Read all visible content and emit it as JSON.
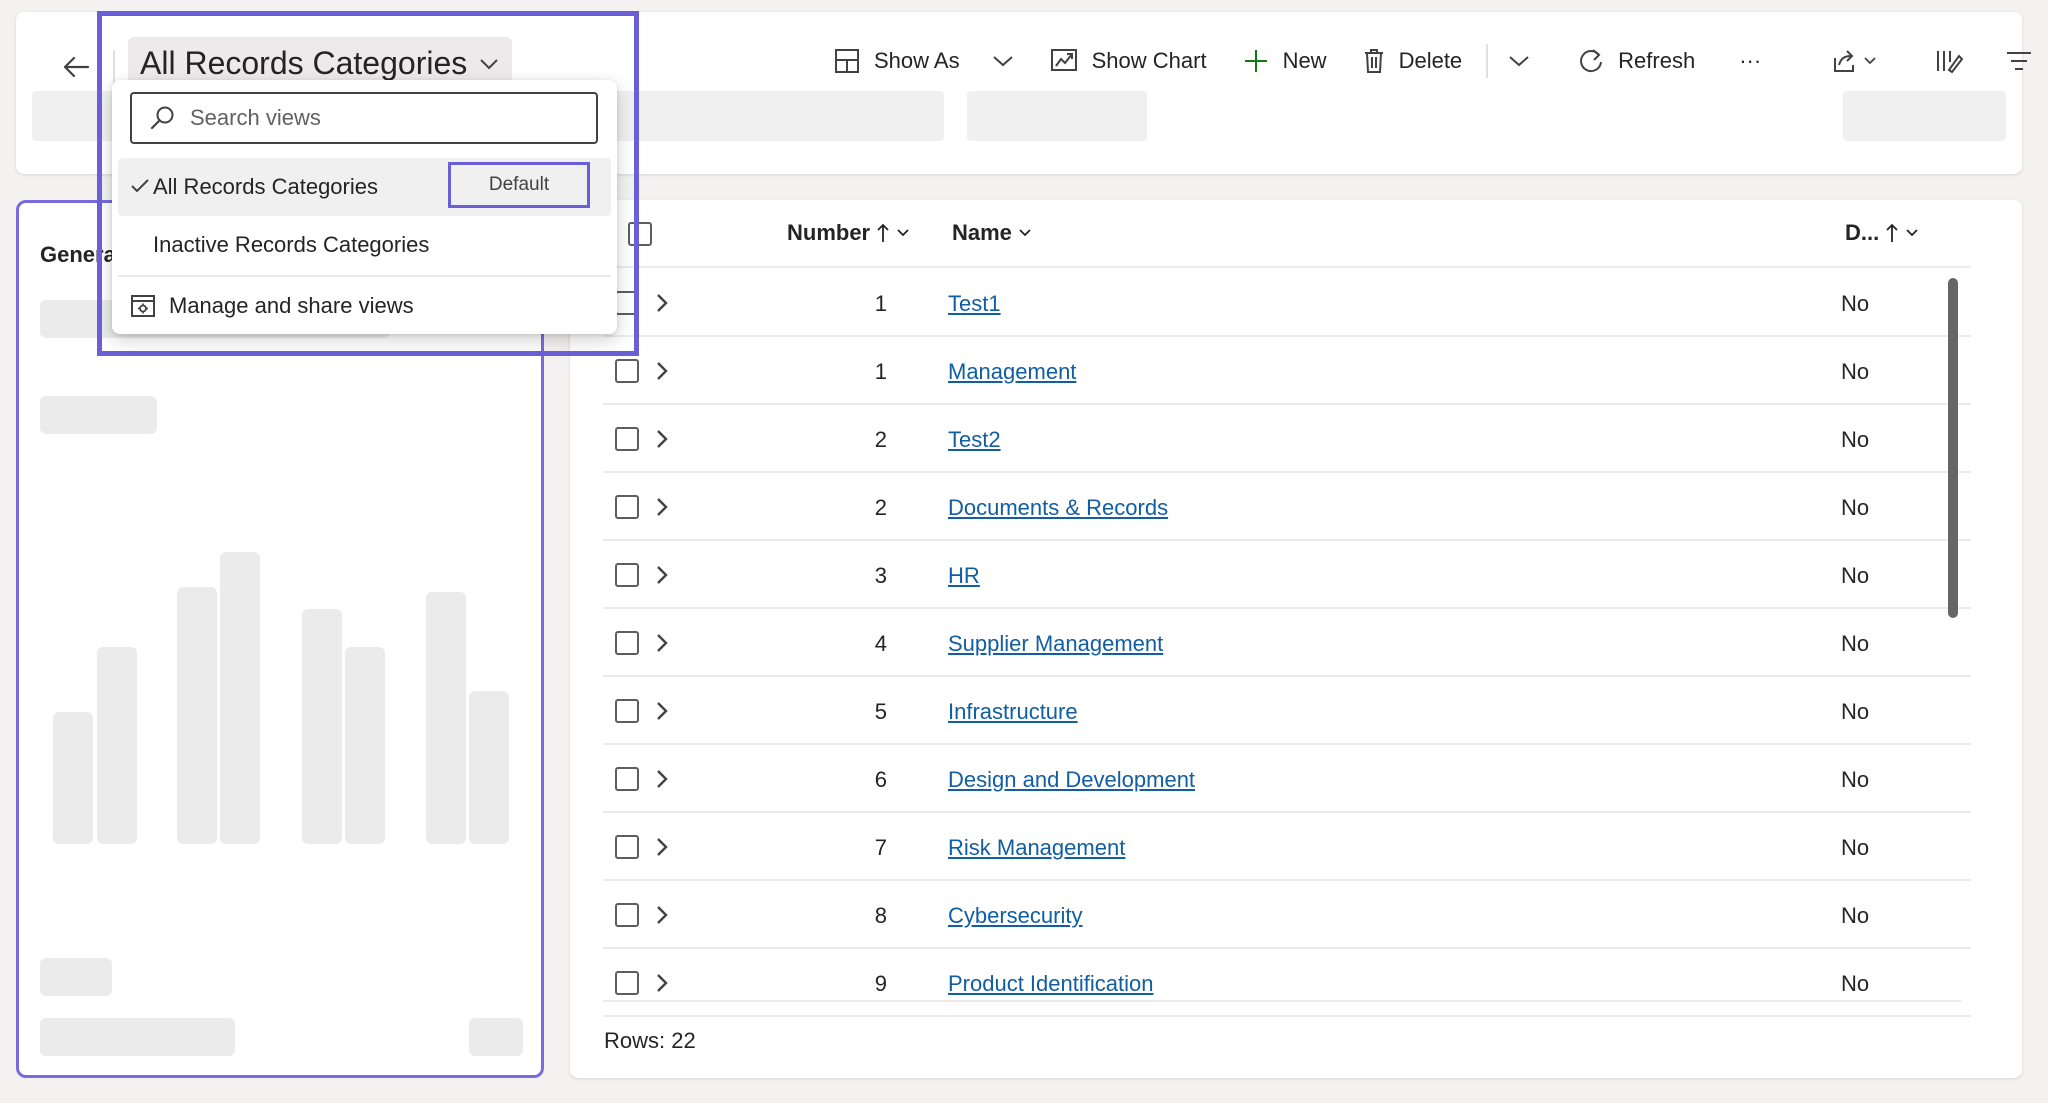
{
  "header": {
    "view_title": "All Records Categories"
  },
  "toolbar": {
    "show_as": "Show As",
    "show_chart": "Show Chart",
    "new": "New",
    "delete": "Delete",
    "refresh": "Refresh",
    "more": "···"
  },
  "view_dropdown": {
    "search_placeholder": "Search views",
    "items": [
      {
        "label": "All Records Categories",
        "selected": true,
        "badge": "Default"
      },
      {
        "label": "Inactive Records Categories",
        "selected": false
      }
    ],
    "manage_label": "Manage and share views"
  },
  "left_panel": {
    "title_visible": "Genera"
  },
  "grid": {
    "columns": [
      {
        "label": "Number",
        "sort": "ascending"
      },
      {
        "label": "Name"
      },
      {
        "label": "D...",
        "sort": "ascending"
      }
    ],
    "rows": [
      {
        "number": "1",
        "name": "Test1",
        "default": "No"
      },
      {
        "number": "1",
        "name": "Management",
        "default": "No"
      },
      {
        "number": "2",
        "name": "Test2",
        "default": "No"
      },
      {
        "number": "2",
        "name": "Documents & Records",
        "default": "No"
      },
      {
        "number": "3",
        "name": "HR",
        "default": "No"
      },
      {
        "number": "4",
        "name": "Supplier Management",
        "default": "No"
      },
      {
        "number": "5",
        "name": "Infrastructure",
        "default": "No"
      },
      {
        "number": "6",
        "name": "Design and Development",
        "default": "No"
      },
      {
        "number": "7",
        "name": "Risk Management",
        "default": "No"
      },
      {
        "number": "8",
        "name": "Cybersecurity",
        "default": "No"
      },
      {
        "number": "9",
        "name": "Product Identification",
        "default": "No"
      }
    ],
    "rows_count": "Rows: 22"
  },
  "colors": {
    "accent_frame": "#6a5fd6",
    "link": "#115ea3",
    "new_plus": "#107c10"
  }
}
